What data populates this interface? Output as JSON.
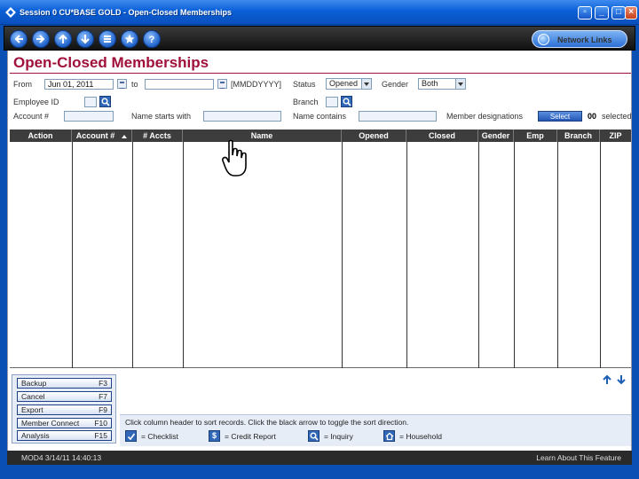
{
  "window": {
    "title": "Session 0 CU*BASE GOLD - Open-Closed Memberships"
  },
  "toolbar": {
    "network_links": "Network Links"
  },
  "page": {
    "title": "Open-Closed Memberships"
  },
  "filters": {
    "from_label": "From",
    "from_value": "Jun 01, 2011",
    "to_label": "to",
    "to_value": "",
    "date_format": "[MMDDYYYY]",
    "status_label": "Status",
    "status_value": "Opened",
    "gender_label": "Gender",
    "gender_value": "Both",
    "employee_id_label": "Employee ID",
    "branch_label": "Branch",
    "account_label": "Account #",
    "name_starts_label": "Name starts with",
    "name_contains_label": "Name contains",
    "member_designations_label": "Member designations",
    "select_button": "Select",
    "selected_count": "00",
    "selected_label": "selected"
  },
  "grid": {
    "columns": [
      "Action",
      "Account #",
      "# Accts",
      "Name",
      "Opened",
      "Closed",
      "Gender",
      "Emp",
      "Branch",
      "ZIP"
    ],
    "rows": []
  },
  "function_keys": [
    {
      "label": "Backup",
      "key": "F3"
    },
    {
      "label": "Cancel",
      "key": "F7"
    },
    {
      "label": "Export",
      "key": "F9"
    },
    {
      "label": "Member Connect",
      "key": "F10"
    },
    {
      "label": "Analysis",
      "key": "F15"
    }
  ],
  "help": {
    "message": "Click column header to sort records. Click the black arrow to toggle the sort direction.",
    "legend": [
      {
        "icon": "checkmark-icon",
        "text": "= Checklist"
      },
      {
        "icon": "dollar-icon",
        "text": "= Credit Report"
      },
      {
        "icon": "magnifier-icon",
        "text": "= Inquiry"
      },
      {
        "icon": "house-icon",
        "text": "= Household"
      }
    ]
  },
  "status_bar": {
    "left": "MOD4 3/14/11 14:40:13",
    "right": "Learn About This Feature"
  },
  "colors": {
    "title": "#a0103a",
    "window_blue": "#0a4fb3",
    "grid_header": "#3d3d3d"
  }
}
